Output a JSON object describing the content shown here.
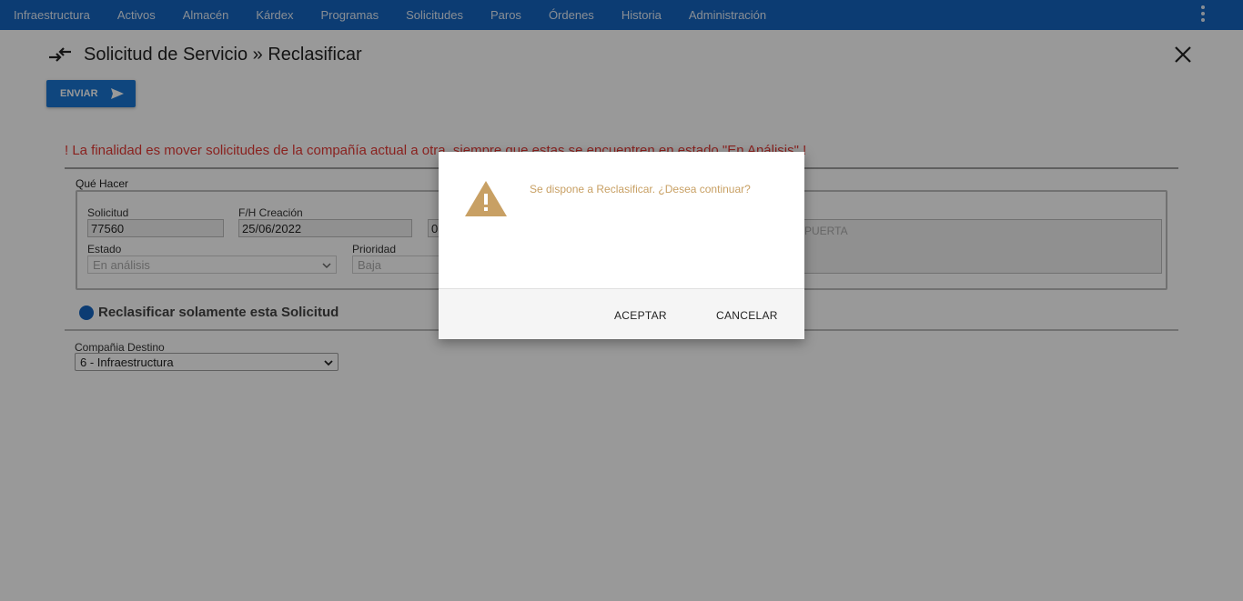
{
  "nav": {
    "items": [
      "Infraestructura",
      "Activos",
      "Almacén",
      "Kárdex",
      "Programas",
      "Solicitudes",
      "Paros",
      "Órdenes",
      "Historia",
      "Administración"
    ]
  },
  "header": {
    "title": "Solicitud de Servicio » Reclasificar",
    "send_label": "ENVIAR"
  },
  "form": {
    "warning": "! La finalidad es mover solicitudes de la compañía actual a otra, siempre que estas se encuentren en estado \"En Análisis\" !",
    "group_label": "Qué Hacer",
    "solicitud_label": "Solicitud",
    "solicitud_value": "77560",
    "fh_label": "F/H Creación",
    "fh_value": "25/06/2022",
    "time_value": "0",
    "estado_label": "Estado",
    "estado_value": "En análisis",
    "prioridad_label": "Prioridad",
    "prioridad_value": "Baja",
    "description_partial": "R PUERTA",
    "reclass_option": "Reclasificar solamente esta Solicitud",
    "company_label": "Compañia Destino",
    "company_value": "6 - Infraestructura"
  },
  "dialog": {
    "message": "Se dispone a Reclasificar. ¿Desea continuar?",
    "accept": "ACEPTAR",
    "cancel": "CANCELAR"
  },
  "colors": {
    "nav_bg": "#1565c0",
    "primary": "#1976d2",
    "warning_text": "#e53935",
    "dialog_icon": "#c8a064"
  }
}
